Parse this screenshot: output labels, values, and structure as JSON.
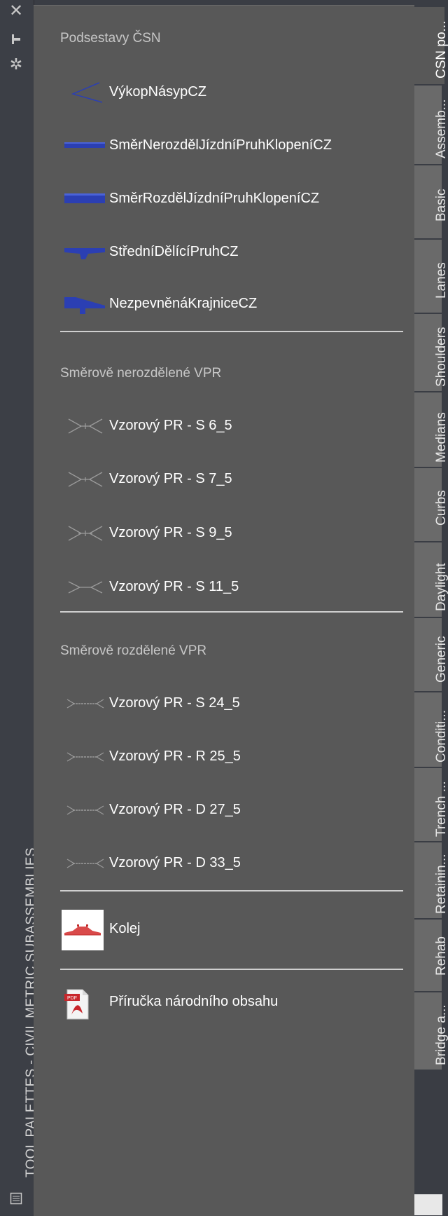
{
  "window": {
    "title": "TOOL PALETTES - CIVIL METRIC SUBASSEMBLIES"
  },
  "titlebar": {
    "close_icon": "close-icon",
    "pin_icon": "pin-icon",
    "gear_icon": "gear-icon",
    "properties_icon": "properties-icon"
  },
  "palette": {
    "sections": [
      {
        "header": "Podsestavy ČSN",
        "items": [
          {
            "label": "VýkopNásypCZ",
            "icon": "cut-fill-icon"
          },
          {
            "label": "SměrNerozdělJízdníPruhKlopeníCZ",
            "icon": "lane-undivided-icon"
          },
          {
            "label": "SměrRozdělJízdníPruhKlopeníCZ",
            "icon": "lane-divided-icon"
          },
          {
            "label": "StředníDělícíPruhCZ",
            "icon": "median-icon"
          },
          {
            "label": "NezpevněnáKrajniceCZ",
            "icon": "shoulder-icon"
          }
        ]
      },
      {
        "header": "Směrově nerozdělené VPR",
        "items": [
          {
            "label": "Vzorový PR - S 6_5",
            "icon": "assembly-icon"
          },
          {
            "label": "Vzorový PR - S 7_5",
            "icon": "assembly-icon"
          },
          {
            "label": "Vzorový PR - S 9_5",
            "icon": "assembly-icon"
          },
          {
            "label": "Vzorový PR - S 11_5",
            "icon": "assembly-icon"
          }
        ]
      },
      {
        "header": "Směrově rozdělené VPR",
        "items": [
          {
            "label": "Vzorový PR - S 24_5",
            "icon": "assembly-icon"
          },
          {
            "label": "Vzorový PR - R 25_5",
            "icon": "assembly-icon"
          },
          {
            "label": "Vzorový PR - D 27_5",
            "icon": "assembly-icon"
          },
          {
            "label": "Vzorový PR - D 33_5",
            "icon": "assembly-icon"
          }
        ]
      }
    ],
    "extra_items": [
      {
        "label": "Kolej",
        "icon": "rail-icon"
      },
      {
        "label": "Příručka národního obsahu",
        "icon": "pdf-icon"
      }
    ]
  },
  "tabs": [
    {
      "label": "CSN po...",
      "active": true
    },
    {
      "label": "Assemb...",
      "active": false
    },
    {
      "label": "Basic",
      "active": false
    },
    {
      "label": "Lanes",
      "active": false
    },
    {
      "label": "Shoulders",
      "active": false
    },
    {
      "label": "Medians",
      "active": false
    },
    {
      "label": "Curbs",
      "active": false
    },
    {
      "label": "Daylight",
      "active": false
    },
    {
      "label": "Generic",
      "active": false
    },
    {
      "label": "Conditi...",
      "active": false
    },
    {
      "label": "Trench ...",
      "active": false
    },
    {
      "label": "Retainin...",
      "active": false
    },
    {
      "label": "Rehab",
      "active": false
    },
    {
      "label": "Bridge a...",
      "active": false
    }
  ],
  "colors": {
    "icon_blue": "#2b3fb3",
    "icon_gray": "#9a9a9a",
    "pdf_red": "#c8262b"
  }
}
